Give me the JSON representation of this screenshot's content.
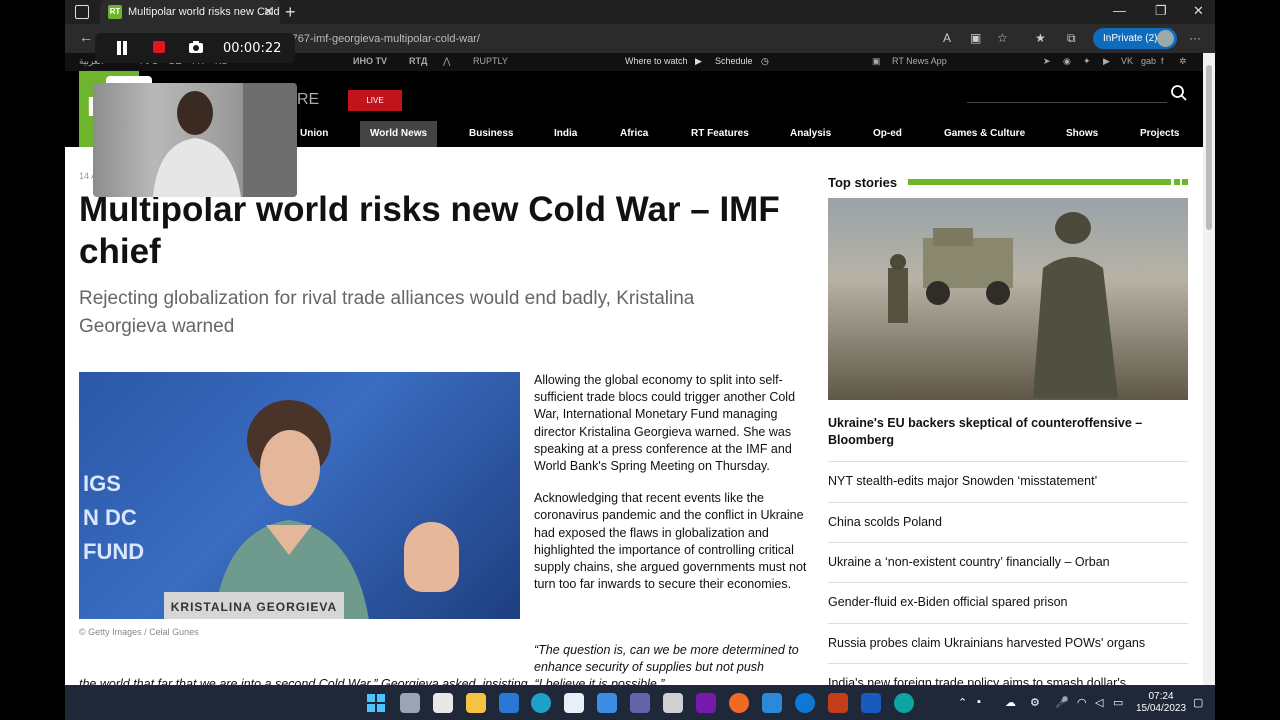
{
  "browser": {
    "tab_title": "Multipolar world risks new Cold W",
    "url": "https://swentr.site/.../574767-imf-georgieva-multipolar-cold-war/",
    "inprivate_label": "InPrivate (2)"
  },
  "rt": {
    "topbar": {
      "lang_arabic": "العربية",
      "lang_ru": "РУС",
      "lang_de": "DE",
      "lang_fr": "FR",
      "lang_rs": "RS",
      "channel_arabic": "ИНО TV",
      "channel_rtd": "RTД",
      "ruptly": "RUPTLY",
      "where_to_watch": "Where to watch",
      "schedule": "Schedule",
      "news_app": "RT News App"
    },
    "logo": "RT",
    "partial_heading": "RE",
    "live_label": "LIVE",
    "nav": [
      {
        "label": "Union"
      },
      {
        "label": "World News"
      },
      {
        "label": "Business"
      },
      {
        "label": "India"
      },
      {
        "label": "Africa"
      },
      {
        "label": "RT Features"
      },
      {
        "label": "Analysis"
      },
      {
        "label": "Op-ed"
      },
      {
        "label": "Games & Culture"
      },
      {
        "label": "Shows"
      },
      {
        "label": "Projects"
      }
    ]
  },
  "article": {
    "date": "14 A",
    "headline": "Multipolar world risks new Cold War – IMF chief",
    "subtitle": "Rejecting globalization for rival trade alliances would end badly, Kristalina Georgieva warned",
    "photo_podium": "KRISTALINA GEORGIEVA",
    "photo_logo": "IGS\nN DC\nFUND",
    "photo_credit": "© Getty Images / Celal Gunes",
    "p1": "Allowing the global economy to split into self-sufficient trade blocs could trigger another Cold War, International Monetary Fund managing director Kristalina Georgieva warned. She was speaking at a press conference at the IMF and World Bank's Spring Meeting on Thursday.",
    "p2": "Acknowledging that recent events like the coronavirus pandemic and the conflict in Ukraine had exposed the flaws in globalization and highlighted the importance of controlling critical supply chains, she argued governments must not turn too far inwards to secure their economies.",
    "quote_line1": "“The question is, can we be more determined to enhance security of supplies but not push",
    "quote_line2": "the world that far that we are into a second Cold War,” Georgieva asked, insisting, “I believe it is possible.”"
  },
  "sidebar": {
    "title": "Top stories",
    "lead": "Ukraine's EU backers skeptical of counteroffensive – Bloomberg",
    "stories": [
      "NYT stealth-edits major Snowden ‘misstatement’",
      "China scolds Poland",
      "Ukraine a ‘non-existent country’ financially – Orban",
      "Gender-fluid ex-Biden official spared prison",
      "Russia probes claim Ukrainians harvested POWs' organs",
      "India's new foreign trade policy aims to smash dollar's"
    ]
  },
  "recorder": {
    "time": "00:00:22",
    "tooltip": "Pause"
  },
  "taskbar": {
    "time": "07:24",
    "date": "15/04/2023"
  },
  "colors": {
    "rt_green": "#6cb52d",
    "live_red": "#c0141c",
    "inprivate_blue": "#0f6cbd"
  }
}
